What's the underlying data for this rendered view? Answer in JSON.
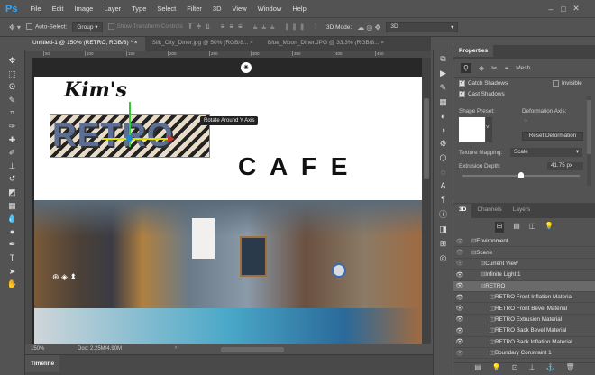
{
  "app": {
    "logo": "Ps"
  },
  "menu": [
    "File",
    "Edit",
    "Image",
    "Layer",
    "Type",
    "Select",
    "Filter",
    "3D",
    "View",
    "Window",
    "Help"
  ],
  "window_controls": [
    "–",
    "□",
    "✕"
  ],
  "options": {
    "auto_select": "Auto-Select:",
    "group": "Group",
    "show_transform": "Show Transform Controls",
    "mode_label": "3D Mode:",
    "mode_value": "3D"
  },
  "tabs": [
    {
      "label": "Untitled-1 @ 150% (RETRO, RGB/8) *"
    },
    {
      "label": "Silk_City_Diner.jpg @ 50% (RGB/8..."
    },
    {
      "label": "Blue_Moon_Diner.JPG @ 33.3% (RGB/8..."
    }
  ],
  "ruler": [
    "50",
    "100",
    "150",
    "200",
    "250",
    "300",
    "350",
    "400",
    "450"
  ],
  "canvas": {
    "kims": "Kim's",
    "retro": "RETRO",
    "cafe": "C A F E",
    "tooltip": "Rotate Around Y Axis"
  },
  "status": {
    "zoom": "150%",
    "doc": "Doc: 2.25M/4.90M"
  },
  "timeline": {
    "label": "Timeline"
  },
  "properties": {
    "title": "Properties",
    "mesh": "Mesh",
    "catch_shadows": "Catch Shadows",
    "cast_shadows": "Cast Shadows",
    "invisible": "Invisible",
    "shape_preset": "Shape Preset:",
    "deformation_axis": "Deformation Axis:",
    "reset_deformation": "Reset Deformation",
    "texture_mapping": "Texture Mapping:",
    "texture_value": "Scale",
    "extrusion_depth": "Extrusion Depth:",
    "extrusion_value": "41.75 px",
    "extrusion_fraction": 0.5
  },
  "panel3d": {
    "tabs": [
      "3D",
      "Channels",
      "Layers"
    ],
    "items": [
      {
        "label": "Environment",
        "indent": 0,
        "eye": "dim"
      },
      {
        "label": "Scene",
        "indent": 0,
        "eye": "dim"
      },
      {
        "label": "Current View",
        "indent": 1,
        "eye": "dim"
      },
      {
        "label": "Infinite Light 1",
        "indent": 1,
        "eye": "on"
      },
      {
        "label": "RETRO",
        "indent": 1,
        "eye": "on",
        "selected": true
      },
      {
        "label": "RETRO Front Inflation Material",
        "indent": 2,
        "eye": "on"
      },
      {
        "label": "RETRO Front Bevel Material",
        "indent": 2,
        "eye": "on"
      },
      {
        "label": "RETRO Extrusion Material",
        "indent": 2,
        "eye": "on"
      },
      {
        "label": "RETRO Back Bevel Material",
        "indent": 2,
        "eye": "on"
      },
      {
        "label": "RETRO Back Inflation Material",
        "indent": 2,
        "eye": "on"
      },
      {
        "label": "Boundary Constraint 1",
        "indent": 2,
        "eye": "dim"
      }
    ]
  }
}
